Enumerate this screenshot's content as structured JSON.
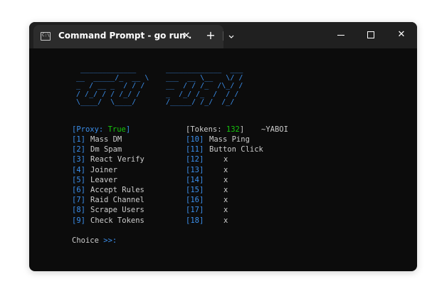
{
  "window": {
    "tab_title": "Command Prompt - go  run .",
    "tab_icon_glyph": "C:\\",
    "close_tab_glyph": "✕",
    "new_tab_glyph": "+",
    "dropdown_glyph": "⌄",
    "close_window_glyph": "✕"
  },
  "banner": {
    "lines_left": [
      "  _____________",
      " __  _____/_  __ \\",
      " _  / __ _  / / /",
      " / /_/ / / /_/ /",
      " \\____/  \\____/"
    ],
    "lines_right": [
      " _____________  ___",
      " ___  __ \\__   \\/ /",
      " __  / / /_  /\\_/ /",
      " _  /_/ /_  /  / /",
      " /_____/ /_/  /_/"
    ]
  },
  "menu": {
    "proxy_label": "[Proxy: ",
    "proxy_value": "True",
    "proxy_close": "]",
    "tokens_label": "[Tokens: ",
    "tokens_value": "132",
    "tokens_close": "]",
    "user_tag": "~YABOI",
    "left_items": [
      {
        "num": "[1]",
        "label": "Mass DM"
      },
      {
        "num": "[2]",
        "label": "Dm Spam"
      },
      {
        "num": "[3]",
        "label": "React Verify"
      },
      {
        "num": "[4]",
        "label": "Joiner"
      },
      {
        "num": "[5]",
        "label": "Leaver"
      },
      {
        "num": "[6]",
        "label": "Accept Rules"
      },
      {
        "num": "[7]",
        "label": "Raid Channel"
      },
      {
        "num": "[8]",
        "label": "Scrape Users"
      },
      {
        "num": "[9]",
        "label": "Check Tokens"
      }
    ],
    "right_items": [
      {
        "num": "[10]",
        "label": "Mass Ping"
      },
      {
        "num": "[11]",
        "label": "Button Click"
      },
      {
        "num": "[12]",
        "label": "x"
      },
      {
        "num": "[13]",
        "label": "x"
      },
      {
        "num": "[14]",
        "label": "x"
      },
      {
        "num": "[15]",
        "label": "x"
      },
      {
        "num": "[16]",
        "label": "x"
      },
      {
        "num": "[17]",
        "label": "x"
      },
      {
        "num": "[18]",
        "label": "x"
      }
    ],
    "prompt_label": "Choice ",
    "prompt_arrows": ">>:"
  },
  "colors": {
    "accent_blue": "#3b8eea",
    "accent_green": "#16c60c",
    "text": "#cccccc",
    "background": "#0c0c0c"
  }
}
